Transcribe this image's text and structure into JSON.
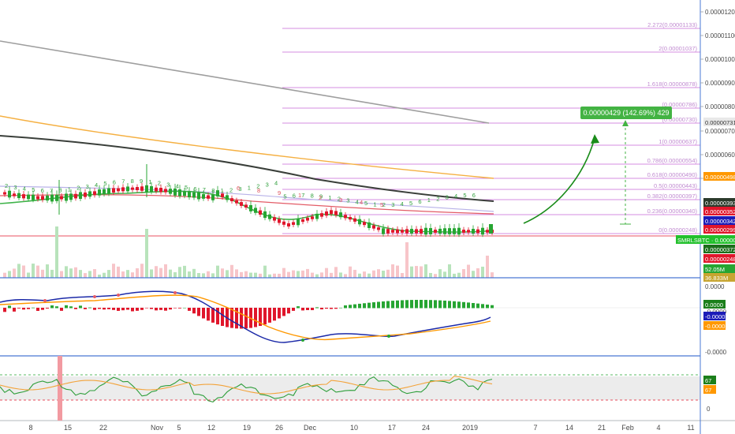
{
  "price_axis": {
    "ticks": [
      "0.00001200",
      "0.00001100",
      "0.00001000",
      "0.00000900",
      "0.00000800",
      "0.00000700",
      "0.00000600",
      "0.00000500"
    ]
  },
  "price_tags": [
    {
      "label": "0.00000731",
      "color": "#e8e8e8",
      "text_color": "#333333"
    },
    {
      "label": "0.00000498",
      "color": "#ff9800",
      "text_color": "#ffffff"
    },
    {
      "label": "0.00000393",
      "color": "#2b3a2b",
      "text_color": "#ffffff"
    },
    {
      "label": "0.00000352",
      "color": "#e0162b",
      "text_color": "#ffffff"
    },
    {
      "label": "0.00000342",
      "color": "#1c1cb8",
      "text_color": "#ffffff"
    },
    {
      "label": "0.00000299",
      "color": "#e0162b",
      "text_color": "#ffffff"
    },
    {
      "label": "SMRLSBTC · 0.00000295",
      "color": "#22c02c",
      "text_color": "#ffffff"
    },
    {
      "label": "0.00000372",
      "color": "#1b6e1b",
      "text_color": "#ffffff"
    },
    {
      "label": "0.00000248",
      "color": "#e0162b",
      "text_color": "#ffffff"
    },
    {
      "label": "52.05M",
      "color": "#26a532",
      "text_color": "#ffffff"
    },
    {
      "label": "36.833M",
      "color": "#c7a530",
      "text_color": "#ffffff"
    }
  ],
  "fib_levels": [
    {
      "label": "2.272(0.00001133)"
    },
    {
      "label": "2(0.00001037)"
    },
    {
      "label": "1.618(0.00000878)"
    },
    {
      "label": "(0.00000786)"
    },
    {
      "label": "(0.00000730)"
    },
    {
      "label": "1(0.00000637)"
    },
    {
      "label": "0.786(0.00000554)"
    },
    {
      "label": "0.618(0.00000490)"
    },
    {
      "label": "0.5(0.00000443)"
    },
    {
      "label": "0.382(0.00000397)"
    },
    {
      "label": "0.236(0.00000340)"
    },
    {
      "label": "0(0.00000248)"
    }
  ],
  "measure_label": "0.00000429 (142.69%) 429",
  "macd_axis": {
    "ticks": [
      "0.0000",
      "-0.0000",
      "-0.0000"
    ]
  },
  "macd_tags": [
    {
      "label": "0.0000",
      "color": "#1b7f1b"
    },
    {
      "label": "-0.0000",
      "color": "#1c1cb8"
    },
    {
      "label": "-0.0000",
      "color": "#ff9800"
    }
  ],
  "rsi_axis": {
    "ticks": [
      "50",
      "0"
    ]
  },
  "rsi_tags": [
    {
      "label": "67",
      "color": "#1b7f1b"
    },
    {
      "label": "67",
      "color": "#ff9800"
    }
  ],
  "x_axis": {
    "labels": [
      "8",
      "15",
      "22",
      "Nov",
      "5",
      "12",
      "19",
      "26",
      "Dec",
      "10",
      "17",
      "24",
      "2019",
      "7",
      "14",
      "21",
      "Feb",
      "4",
      "11"
    ]
  },
  "td_labels_green": [
    "2",
    "3",
    "4",
    "5",
    "6",
    "7",
    "8",
    "1",
    "2",
    "3",
    "4",
    "5",
    "6",
    "7",
    "8",
    "9",
    "1",
    "2",
    "3",
    "4",
    "5",
    "6",
    "7",
    "8",
    "1",
    "2",
    "3",
    "1",
    "2",
    "3",
    "4",
    "5",
    "6",
    "7",
    "8",
    "9",
    "1",
    "2",
    "3",
    "4",
    "5",
    "1",
    "2",
    "3",
    "4",
    "5",
    "6",
    "1",
    "2",
    "3",
    "4",
    "5",
    "6"
  ],
  "td_labels_red": [
    "6",
    "8",
    "9",
    "1",
    "2",
    "3",
    "4",
    "5"
  ],
  "colors": {
    "up": "#26a532",
    "down": "#e0162b",
    "ma_gray": "#9e9e9e",
    "ma_orange": "#f5b042",
    "ma_black": "#3a3f3a",
    "ma_purple": "#b8b2e8",
    "ma_red": "#e35c67",
    "ma_green": "#3fb34a",
    "fib": "#d48ce0",
    "arrow": "#1a8c1a",
    "measure": "#43b343",
    "macd_fast": "#1c2aa8",
    "macd_slow": "#ff9800",
    "rsi_green": "#2e9e3a",
    "rsi_orange": "#f3a33a",
    "pane_border": "#4a78d4"
  }
}
